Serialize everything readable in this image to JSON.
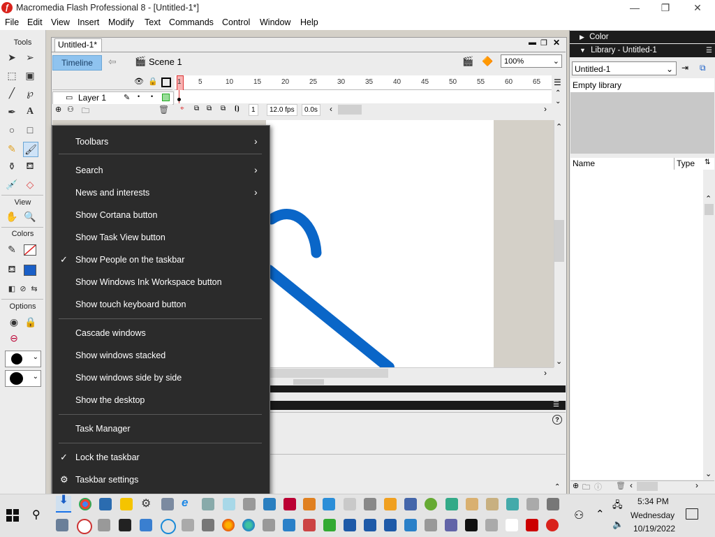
{
  "window": {
    "title": "Macromedia Flash Professional 8 - [Untitled-1*]",
    "app_icon": "flash-icon",
    "controls": [
      "minimize-icon",
      "restore-icon",
      "close-icon"
    ]
  },
  "menubar": [
    "File",
    "Edit",
    "View",
    "Insert",
    "Modify",
    "Text",
    "Commands",
    "Control",
    "Window",
    "Help"
  ],
  "tools": {
    "header": "Tools",
    "view_header": "View",
    "colors_header": "Colors",
    "options_header": "Options",
    "stroke_color": "#000000",
    "fill_color": "#1a5fc7"
  },
  "document": {
    "tab": "Untitled-1*",
    "timeline_button": "Timeline",
    "scene": "Scene 1",
    "zoom": "100%",
    "layer": "Layer 1",
    "ruler_ticks": [
      "1",
      "5",
      "10",
      "15",
      "20",
      "25",
      "30",
      "35",
      "40",
      "45",
      "50",
      "55",
      "60",
      "65"
    ],
    "current_frame": "1",
    "fps": "12.0 fps",
    "time": "0.0s",
    "stroke_color": "#0a66c8"
  },
  "library": {
    "color_panel": "Color",
    "panel_title": "Library - Untitled-1",
    "select_value": "Untitled-1",
    "empty_text": "Empty library",
    "col_name": "Name",
    "col_type": "Type"
  },
  "context_menu": {
    "items": [
      {
        "label": "Toolbars",
        "submenu": true
      },
      {
        "label": "Search",
        "submenu": true
      },
      {
        "label": "News and interests",
        "submenu": true
      },
      {
        "label": "Show Cortana button"
      },
      {
        "label": "Show Task View button"
      },
      {
        "label": "Show People on the taskbar",
        "checked": true
      },
      {
        "label": "Show Windows Ink Workspace button"
      },
      {
        "label": "Show touch keyboard button"
      },
      {
        "label": "Cascade windows"
      },
      {
        "label": "Show windows stacked"
      },
      {
        "label": "Show windows side by side"
      },
      {
        "label": "Show the desktop"
      },
      {
        "label": "Task Manager"
      },
      {
        "label": "Lock the taskbar",
        "checked": true
      },
      {
        "label": "Taskbar settings",
        "icon": "gear-icon"
      }
    ]
  },
  "taskbar": {
    "time": "5:34 PM",
    "day": "Wednesday",
    "date": "10/19/2022"
  }
}
